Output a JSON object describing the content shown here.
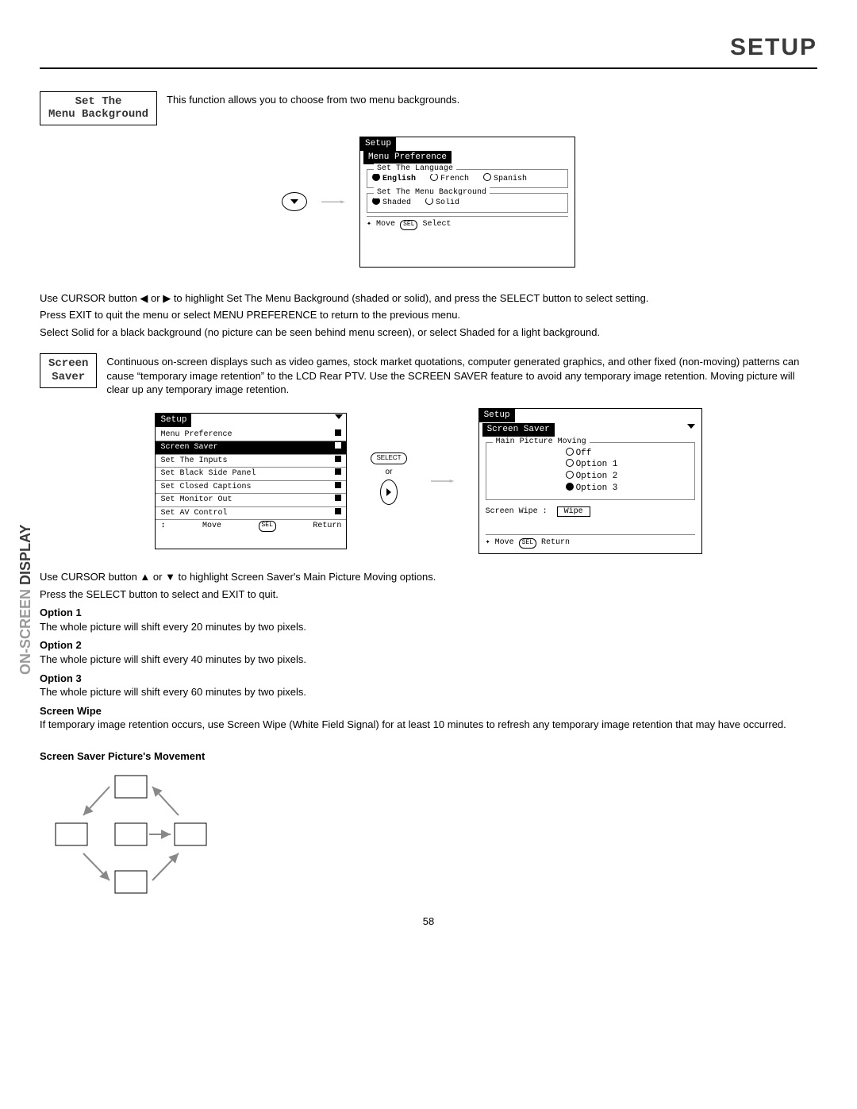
{
  "header": {
    "title": "SETUP"
  },
  "side_tab": {
    "light": "ON-SCREEN ",
    "dark": "DISPLAY"
  },
  "section1": {
    "label_line1": "Set The",
    "label_line2": "Menu Background",
    "intro": "This function allows you to choose from two menu backgrounds."
  },
  "osd1": {
    "tab": "Setup",
    "sub": "Menu Preference",
    "group1_title": "Set The Language",
    "lang": {
      "a": "English",
      "b": "French",
      "c": "Spanish"
    },
    "group2_title": "Set The Menu Background",
    "bg": {
      "a": "Shaded",
      "b": "Solid"
    },
    "footer_move": "Move",
    "footer_sel": "SEL",
    "footer_select": "Select"
  },
  "para1": "Use CURSOR button ◀ or ▶ to highlight Set The Menu Background (shaded or solid), and press the SELECT button to select setting.",
  "para2": "Press EXIT to quit the menu or select MENU PREFERENCE to return to the previous menu.",
  "para3": "Select Solid for a black background (no picture can be seen behind menu screen), or select Shaded for a light background.",
  "section2": {
    "label_line1": "Screen",
    "label_line2": "Saver",
    "intro": "Continuous on-screen displays such as video games, stock market quotations, computer generated graphics, and other fixed (non-moving) patterns can cause “temporary image retention” to the LCD Rear PTV.  Use the SCREEN SAVER feature to avoid any temporary image retention.  Moving picture will clear up any temporary image retention."
  },
  "osd2a": {
    "tab": "Setup",
    "items": [
      "Menu Preference",
      "Screen Saver",
      "Set The Inputs",
      "Set Black Side Panel",
      "Set Closed Captions",
      "Set Monitor Out",
      "Set AV Control"
    ],
    "hl_index": 1,
    "footer_move": "Move",
    "footer_sel": "SEL",
    "footer_return": "Return"
  },
  "mid": {
    "select_label": "SELECT",
    "or": "or"
  },
  "osd2b": {
    "tab": "Setup",
    "sub": "Screen Saver",
    "group_title": "Main Picture Moving",
    "opts": {
      "off": "Off",
      "o1": "Option 1",
      "o2": "Option 2",
      "o3": "Option 3"
    },
    "wipe_label": "Screen Wipe :",
    "wipe_btn": "Wipe",
    "footer_move": "Move",
    "footer_sel": "SEL",
    "footer_return": "Return"
  },
  "para4": "Use CURSOR button ▲ or ▼ to highlight Screen Saver's Main Picture Moving options.",
  "para5": "Press the SELECT button to select and EXIT to quit.",
  "options": {
    "o1_h": "Option 1",
    "o1_t": "The whole picture will shift every 20 minutes by two pixels.",
    "o2_h": "Option 2",
    "o2_t": "The whole picture will shift every 40 minutes by two pixels.",
    "o3_h": "Option 3",
    "o3_t": "The whole picture will shift every 60 minutes by two pixels.",
    "sw_h": "Screen Wipe",
    "sw_t": "If temporary image retention occurs, use Screen Wipe (White Field Signal) for at least 10 minutes to refresh any temporary image retention that may have occurred.",
    "mv_h": "Screen Saver Picture's Movement"
  },
  "page_number": "58"
}
